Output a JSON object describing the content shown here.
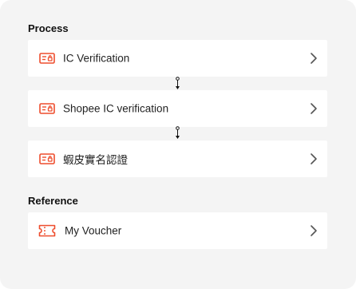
{
  "process": {
    "title": "Process",
    "items": [
      {
        "label": "IC Verification",
        "icon": "id-card-icon"
      },
      {
        "label": "Shopee IC verification",
        "icon": "id-card-icon"
      },
      {
        "label": "蝦皮實名認證",
        "icon": "id-card-icon"
      }
    ]
  },
  "reference": {
    "title": "Reference",
    "items": [
      {
        "label": "My Voucher",
        "icon": "voucher-icon"
      }
    ]
  },
  "colors": {
    "accent": "#ee4d2d",
    "panel_bg": "#f4f4f4",
    "card_bg": "#ffffff",
    "chevron": "#555555"
  }
}
